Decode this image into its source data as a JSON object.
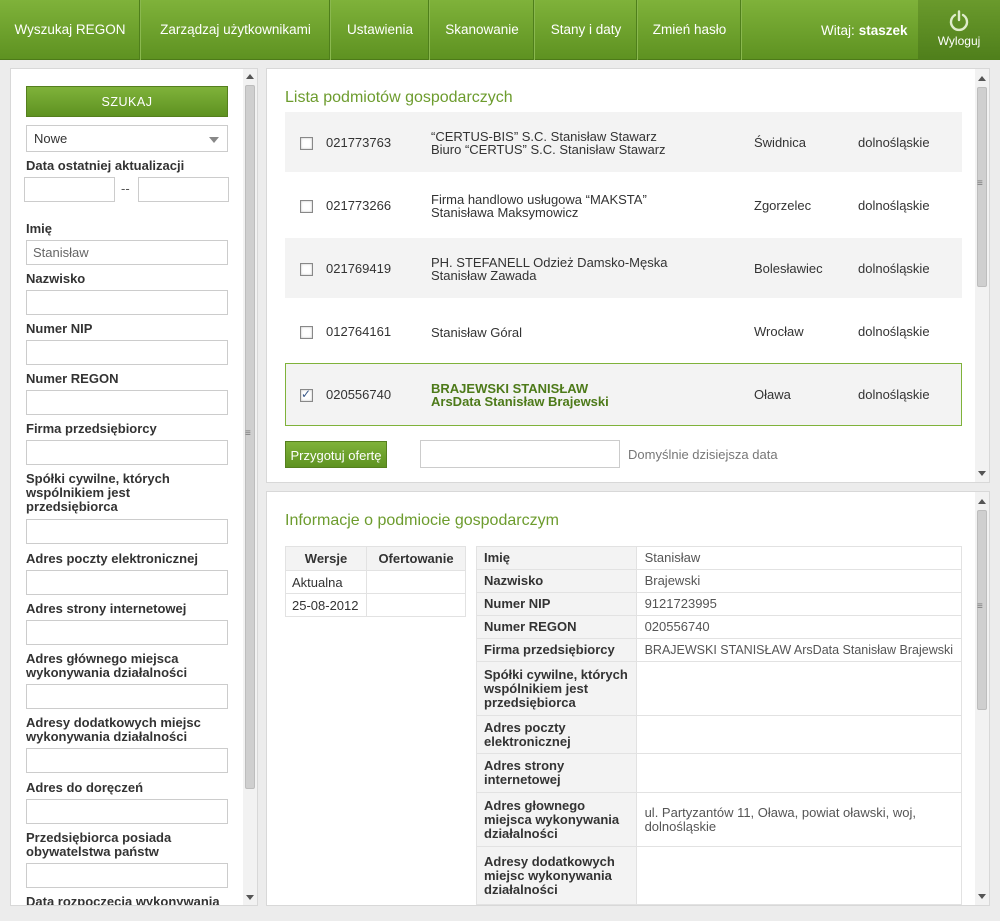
{
  "nav": {
    "items": [
      "Wyszukaj REGON",
      "Zarządzaj użytkownikami",
      "Ustawienia",
      "Skanowanie",
      "Stany i daty",
      "Zmień hasło"
    ],
    "welcome_prefix": "Witaj:",
    "username": "staszek",
    "logout_label": "Wyloguj"
  },
  "search": {
    "button": "SZUKAJ",
    "status_select": "Nowe",
    "date_label": "Data ostatniej aktualizacji",
    "date_separator": "--",
    "fields": [
      {
        "label": "Imię",
        "value": "Stanisław"
      },
      {
        "label": "Nazwisko",
        "value": ""
      },
      {
        "label": "Numer NIP",
        "value": ""
      },
      {
        "label": "Numer REGON",
        "value": ""
      },
      {
        "label": "Firma przedsiębiorcy",
        "value": ""
      },
      {
        "label": "Spółki cywilne, których wspólnikiem jest przedsiębiorca",
        "value": ""
      },
      {
        "label": "Adres poczty elektronicznej",
        "value": ""
      },
      {
        "label": "Adres strony internetowej",
        "value": ""
      },
      {
        "label": "Adres głównego miejsca wykonywania działalności",
        "value": ""
      },
      {
        "label": "Adresy dodatkowych miejsc wykonywania działalności",
        "value": ""
      },
      {
        "label": "Adres do doręczeń",
        "value": ""
      },
      {
        "label": "Przedsiębiorca posiada obywatelstwa państw",
        "value": ""
      },
      {
        "label": "Data rozpoczęcia wykonywania",
        "value": ""
      }
    ]
  },
  "list": {
    "title": "Lista podmiotów gospodarczych",
    "rows": [
      {
        "regon": "021773763",
        "name1": "“CERTUS-BIS” S.C. Stanisław Stawarz",
        "name2": "Biuro “CERTUS” S.C. Stanisław Stawarz",
        "city": "Świdnica",
        "province": "dolnośląskie",
        "checked": false
      },
      {
        "regon": "021773266",
        "name1": "Firma handlowo usługowa “MAKSTA”",
        "name2": "Stanisława Maksymowicz",
        "city": "Zgorzelec",
        "province": "dolnośląskie",
        "checked": false
      },
      {
        "regon": "021769419",
        "name1": "PH. STEFANELL Odzież Damsko-Męska",
        "name2": "Stanisław Zawada",
        "city": "Bolesławiec",
        "province": "dolnośląskie",
        "checked": false
      },
      {
        "regon": "012764161",
        "name1": "Stanisław Góral",
        "name2": "",
        "city": "Wrocław",
        "province": "dolnośląskie",
        "checked": false
      },
      {
        "regon": "020556740",
        "name1": "BRAJEWSKI STANISŁAW",
        "name2": "ArsData Stanisław Brajewski",
        "city": "Oława",
        "province": "dolnośląskie",
        "checked": true
      }
    ],
    "offer_button": "Przygotuj ofertę",
    "offer_date_value": "",
    "offer_hint": "Domyślnie dzisiejsza data"
  },
  "info": {
    "title": "Informacje o podmiocie gospodarczym",
    "versions_header": [
      "Wersje",
      "Ofertowanie"
    ],
    "versions": [
      {
        "version": "Aktualna",
        "offer": ""
      },
      {
        "version": "25-08-2012",
        "offer": ""
      }
    ],
    "details": [
      {
        "key": "Imię",
        "value": "Stanisław"
      },
      {
        "key": "Nazwisko",
        "value": "Brajewski"
      },
      {
        "key": "Numer NIP",
        "value": "9121723995"
      },
      {
        "key": "Numer REGON",
        "value": "020556740"
      },
      {
        "key": "Firma przedsiębiorcy",
        "value": "BRAJEWSKI STANISŁAW ArsData Stanisław Brajewski"
      },
      {
        "key": "Spółki cywilne, których wspólnikiem jest przedsiębiorca",
        "value": ""
      },
      {
        "key": "Adres poczty elektronicznej",
        "value": ""
      },
      {
        "key": "Adres strony internetowej",
        "value": ""
      },
      {
        "key": "Adres głownego miejsca wykonywania działalności",
        "value": "ul. Partyzantów 11, Oława, powiat oławski, woj, dolnośląskie"
      },
      {
        "key": "Adresy dodatkowych miejsc wykonywania działalności",
        "value": ""
      }
    ]
  },
  "colors": {
    "accent": "#6d9c2e",
    "nav": "#6a9e2a"
  }
}
